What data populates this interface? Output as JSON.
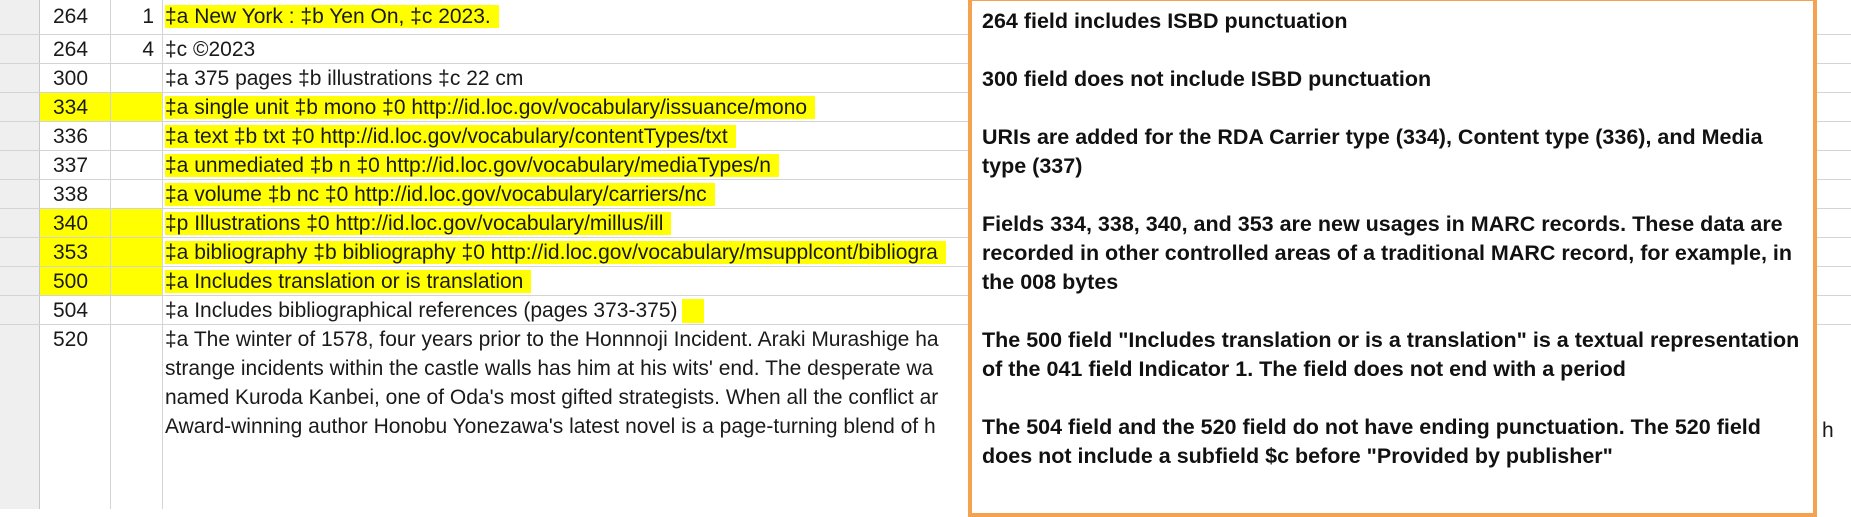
{
  "records": [
    {
      "tag": "264",
      "ind1": "",
      "ind2": "1",
      "data": "‡a New York : ‡b Yen On, ‡c 2023.",
      "highlight_data": true,
      "highlight_tag": false
    },
    {
      "tag": "264",
      "ind1": "",
      "ind2": "4",
      "data": "‡c ©2023",
      "highlight_data": false,
      "highlight_tag": false
    },
    {
      "tag": "300",
      "ind1": "",
      "ind2": "",
      "data": "‡a 375 pages ‡b illustrations ‡c 22 cm",
      "highlight_data": false,
      "highlight_tag": false
    },
    {
      "tag": "334",
      "ind1": "",
      "ind2": "",
      "data": "‡a single unit ‡b mono ‡0 http://id.loc.gov/vocabulary/issuance/mono",
      "highlight_data": true,
      "highlight_tag": true
    },
    {
      "tag": "336",
      "ind1": "",
      "ind2": "",
      "data": "‡a text ‡b txt ‡0 http://id.loc.gov/vocabulary/contentTypes/txt",
      "highlight_data": true,
      "highlight_tag": false
    },
    {
      "tag": "337",
      "ind1": "",
      "ind2": "",
      "data": "‡a unmediated ‡b n ‡0 http://id.loc.gov/vocabulary/mediaTypes/n",
      "highlight_data": true,
      "highlight_tag": false
    },
    {
      "tag": "338",
      "ind1": "",
      "ind2": "",
      "data": "‡a volume ‡b nc ‡0 http://id.loc.gov/vocabulary/carriers/nc",
      "highlight_data": true,
      "highlight_tag": false
    },
    {
      "tag": "340",
      "ind1": "",
      "ind2": "",
      "data": "‡p Illustrations ‡0 http://id.loc.gov/vocabulary/millus/ill",
      "highlight_data": true,
      "highlight_tag": true
    },
    {
      "tag": "353",
      "ind1": "",
      "ind2": "",
      "data": "‡a bibliography ‡b bibliography ‡0 http://id.loc.gov/vocabulary/msupplcont/bibliogra",
      "highlight_data": true,
      "highlight_tag": true
    },
    {
      "tag": "500",
      "ind1": "",
      "ind2": "",
      "data": "‡a Includes translation or is translation",
      "highlight_data": true,
      "highlight_tag": true
    },
    {
      "tag": "504",
      "ind1": "",
      "ind2": "",
      "data": "‡a Includes bibliographical references (pages 373-375)",
      "highlight_data": false,
      "highlight_tag": false
    },
    {
      "tag": "520",
      "ind1": "",
      "ind2": "",
      "data_lines": [
        "‡a The winter of 1578, four years prior to the Honnnoji Incident. Araki Murashige ha",
        "strange incidents within the castle walls has him at his wits' end. The desperate wa",
        "named Kuroda Kanbei, one of Oda's most gifted strategists. When all the conflict ar",
        "Award-winning author Honobu Yonezawa's latest novel is a page-turning blend of h"
      ],
      "highlight_data": false,
      "highlight_tag": false
    }
  ],
  "overflow_char": "h",
  "callout": {
    "paragraphs": [
      "264 field includes ISBD punctuation",
      "300 field does not include ISBD punctuation",
      "URIs are added for the RDA Carrier type (334), Content type (336), and Media type (337)",
      "Fields 334, 338, 340, and 353 are new usages in MARC records. These data are recorded in other controlled areas of a traditional MARC record, for example, in the 008 bytes",
      "The 500 field \"Includes translation or is a translation\" is a textual representation of the 041 field Indicator 1. The field does not end with a period",
      "The 504 field and the 520 field do not have ending punctuation. The 520 field does not include a subfield $c before \"Provided by publisher\""
    ]
  },
  "colors": {
    "highlight": "#ffff00",
    "callout_border": "#f4a150",
    "grid_line": "#d4d4d4",
    "row_header": "#efefef"
  }
}
